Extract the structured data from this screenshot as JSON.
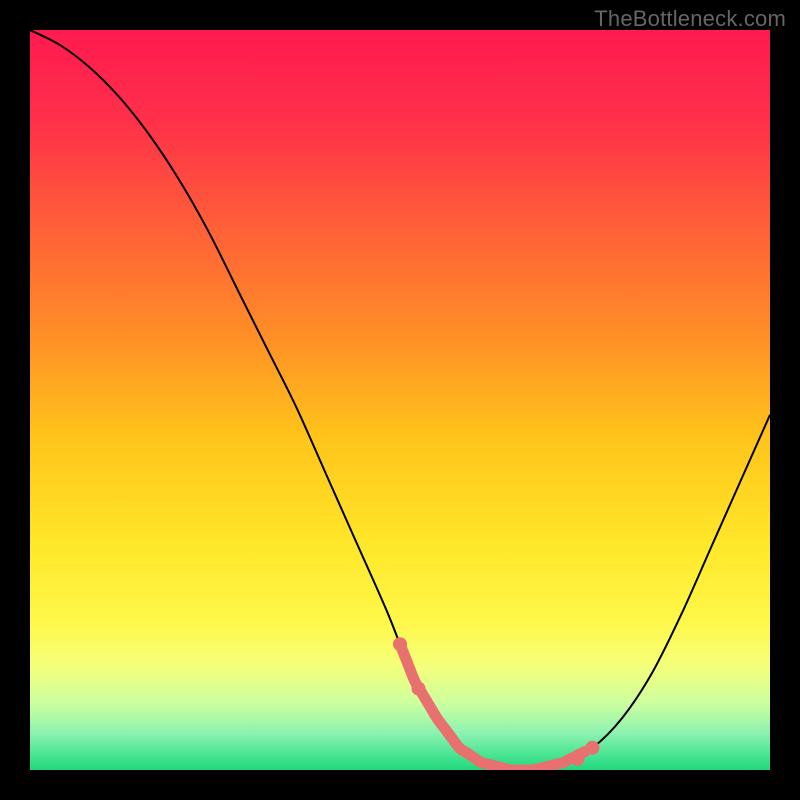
{
  "watermark": "TheBottleneck.com",
  "colors": {
    "background": "#000000",
    "curve": "#000000",
    "highlight": "#e8716f",
    "gradient_stops": [
      {
        "offset": 0.0,
        "color": "#ff1a4f"
      },
      {
        "offset": 0.12,
        "color": "#ff2f4a"
      },
      {
        "offset": 0.25,
        "color": "#ff5a3a"
      },
      {
        "offset": 0.4,
        "color": "#ff8a28"
      },
      {
        "offset": 0.55,
        "color": "#ffc41a"
      },
      {
        "offset": 0.7,
        "color": "#ffe82a"
      },
      {
        "offset": 0.8,
        "color": "#fff84a"
      },
      {
        "offset": 0.86,
        "color": "#f4ff7a"
      },
      {
        "offset": 0.91,
        "color": "#ccffa0"
      },
      {
        "offset": 0.95,
        "color": "#8cf2b0"
      },
      {
        "offset": 0.985,
        "color": "#3de28e"
      },
      {
        "offset": 1.0,
        "color": "#22d67a"
      }
    ]
  },
  "chart_data": {
    "type": "line",
    "title": "",
    "xlabel": "",
    "ylabel": "",
    "xlim": [
      0,
      100
    ],
    "ylim": [
      0,
      100
    ],
    "series": [
      {
        "name": "bottleneck-curve",
        "x": [
          0,
          4,
          8,
          12,
          16,
          20,
          24,
          28,
          32,
          36,
          40,
          44,
          48,
          50,
          52,
          55,
          58,
          61,
          65,
          68,
          72,
          76,
          80,
          84,
          88,
          92,
          96,
          100
        ],
        "values": [
          100,
          98,
          95,
          91,
          86,
          80,
          73,
          65,
          57,
          49,
          40,
          31,
          22,
          17,
          12,
          7,
          3,
          1,
          0,
          0,
          1,
          3,
          7,
          13,
          21,
          30,
          39,
          48
        ]
      }
    ],
    "highlight": {
      "description": "optimal flat region near minimum",
      "x_start": 50,
      "x_end": 75,
      "dots": [
        {
          "x": 50.0,
          "v": 17
        },
        {
          "x": 52.5,
          "v": 11
        },
        {
          "x": 74.0,
          "v": 1.5
        },
        {
          "x": 76.0,
          "v": 3.0
        }
      ],
      "stroke_width_px": 11,
      "dot_radius_px": 7
    }
  }
}
